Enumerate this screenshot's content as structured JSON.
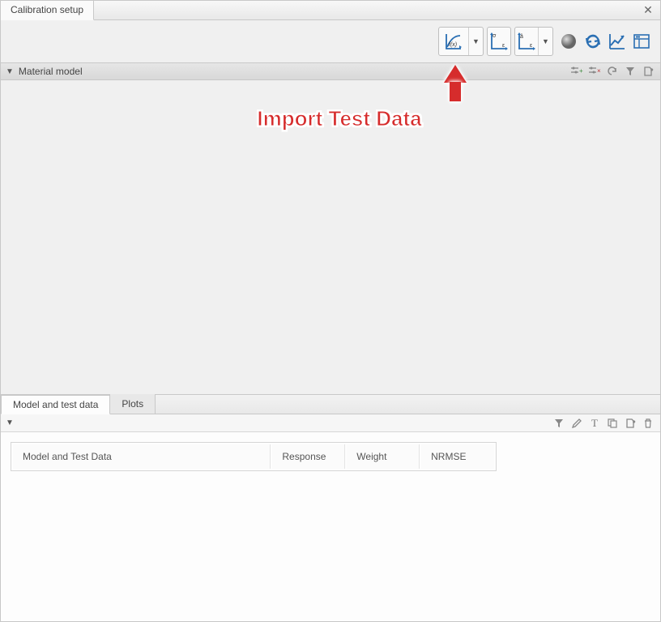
{
  "window": {
    "title": "Calibration setup"
  },
  "toolbar": {
    "buttons": {
      "fx": "function-curve",
      "sigma_eps": "import-test-data",
      "hat_eps": "strain-model",
      "sphere": "material",
      "refresh": "refresh",
      "chart": "chart",
      "layout": "layout"
    }
  },
  "sections": {
    "material_model": {
      "label": "Material model"
    }
  },
  "annotation": {
    "text": "Import Test Data"
  },
  "bottom": {
    "tabs": [
      "Model and test data",
      "Plots"
    ],
    "active_tab": 0,
    "table": {
      "columns": [
        "Model and Test Data",
        "Response",
        "Weight",
        "NRMSE"
      ]
    }
  }
}
